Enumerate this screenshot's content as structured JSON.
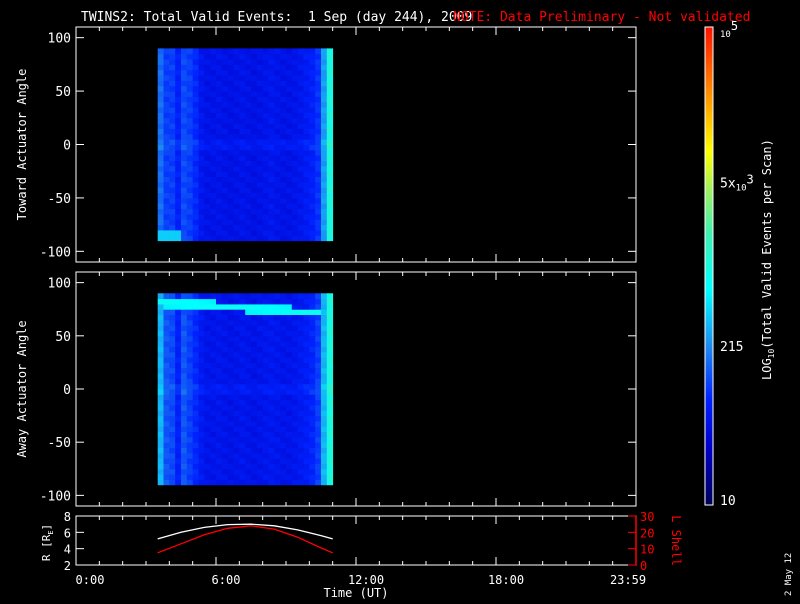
{
  "chart_data": {
    "type": "heatmap",
    "title": "TWINS2: Total Valid Events:  1 Sep (day 244), 2009",
    "note": "NOTE: Data Preliminary - Not validated",
    "date_stamp": "2 May 12",
    "xlabel": "Time (UT)",
    "xlim_hours": [
      0,
      24
    ],
    "x_tick_hours": [
      0,
      6,
      12,
      18,
      24
    ],
    "x_tick_labels": [
      "0:00",
      "6:00",
      "12:00",
      "18:00",
      "23:59"
    ],
    "colorbar": {
      "label": "LOG10(Total Valid Events per Scan)",
      "label_main": "LOG",
      "label_sub": "10",
      "label_rest": "(Total Valid Events per Scan)",
      "range_log10": [
        1,
        5
      ],
      "ticks": [
        {
          "log10": 1,
          "label": "10"
        },
        {
          "log10": 2.332,
          "label": "215"
        },
        {
          "log10": 3.699,
          "label": "5x10",
          "sup": "3"
        },
        {
          "log10": 5,
          "label": "10",
          "sup": "5"
        }
      ]
    },
    "panels": [
      {
        "ylabel": "Toward Actuator Angle",
        "ylim": [
          -110,
          110
        ],
        "yticks": [
          100,
          50,
          0,
          -50,
          -100
        ],
        "data_time_range_hours": [
          3.5,
          11.0
        ],
        "data_angle_range": [
          -90,
          90
        ],
        "column_log10": [
          2.2,
          2.0,
          2.0,
          1.85,
          2.05,
          2.0,
          1.9,
          1.75,
          1.7,
          1.7,
          1.72,
          1.7,
          1.68,
          1.7,
          1.72,
          1.7,
          1.68,
          1.7,
          1.72,
          1.75,
          1.72,
          1.7,
          1.7,
          1.72,
          1.75,
          1.8,
          1.85,
          1.95,
          2.4,
          3.0
        ],
        "feature": {
          "angle_range": [
            -90,
            -80
          ],
          "time_range_hours": [
            3.5,
            4.4
          ],
          "log10": 2.6
        }
      },
      {
        "ylabel": "Away Actuator Angle",
        "ylim": [
          -110,
          110
        ],
        "yticks": [
          100,
          50,
          0,
          -50,
          -100
        ],
        "data_time_range_hours": [
          3.5,
          11.0
        ],
        "data_angle_range": [
          -90,
          90
        ],
        "column_log10": [
          2.5,
          2.1,
          2.05,
          1.85,
          2.1,
          2.0,
          1.9,
          1.78,
          1.72,
          1.72,
          1.74,
          1.72,
          1.7,
          1.72,
          1.74,
          1.72,
          1.7,
          1.72,
          1.74,
          1.76,
          1.74,
          1.72,
          1.72,
          1.74,
          1.78,
          1.82,
          1.88,
          2.0,
          2.5,
          3.0
        ],
        "feature": {
          "angle_center_start": 82,
          "angle_center_end": 72,
          "width_deg": 8,
          "time_range_hours": [
            3.5,
            10.4
          ],
          "log10": 2.9
        }
      },
      {
        "ylabel": "R [R",
        "ylabel_sub": "E",
        "ylabel_end": "]",
        "ylim": [
          2,
          8
        ],
        "yticks": [
          8,
          6,
          4,
          2
        ],
        "y2label": "L Shell",
        "y2lim": [
          0,
          30
        ],
        "y2ticks": [
          30,
          20,
          10,
          0
        ],
        "series": [
          {
            "name": "R",
            "color": "#ffffff",
            "x_hours": [
              3.5,
              4.5,
              5.5,
              6.5,
              7.5,
              8.5,
              9.5,
              10.5,
              11.0
            ],
            "y": [
              5.2,
              6.0,
              6.6,
              6.95,
              7.0,
              6.8,
              6.3,
              5.6,
              5.2
            ]
          },
          {
            "name": "L Shell",
            "color": "#ff0000",
            "axis": "right",
            "x_hours": [
              3.5,
              4.5,
              5.5,
              6.5,
              7.5,
              8.5,
              9.5,
              10.5,
              11.0
            ],
            "y": [
              7.5,
              13,
              18.5,
              22.5,
              24,
              22,
              17,
              10.5,
              7.5
            ]
          }
        ]
      }
    ]
  }
}
